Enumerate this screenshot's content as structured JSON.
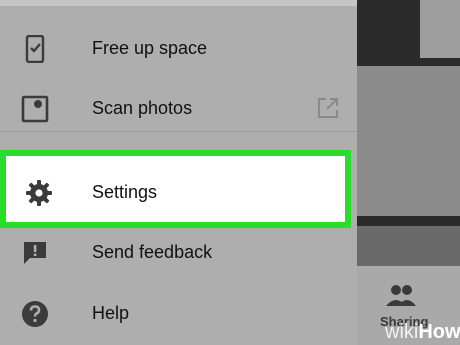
{
  "menu": {
    "items": [
      {
        "label": "Free up space",
        "icon": "phone-check-icon"
      },
      {
        "label": "Scan photos",
        "icon": "photo-scan-icon"
      },
      {
        "label": "Settings",
        "icon": "gear-icon"
      },
      {
        "label": "Send feedback",
        "icon": "feedback-icon"
      },
      {
        "label": "Help",
        "icon": "help-icon"
      }
    ]
  },
  "background": {
    "sharing_label": "Sharing"
  },
  "watermark": {
    "wiki": "wiki",
    "how": "How"
  },
  "colors": {
    "highlight_border": "#2bdc2b",
    "drawer": "#aeaeae",
    "icon": "#3b3b3b"
  }
}
